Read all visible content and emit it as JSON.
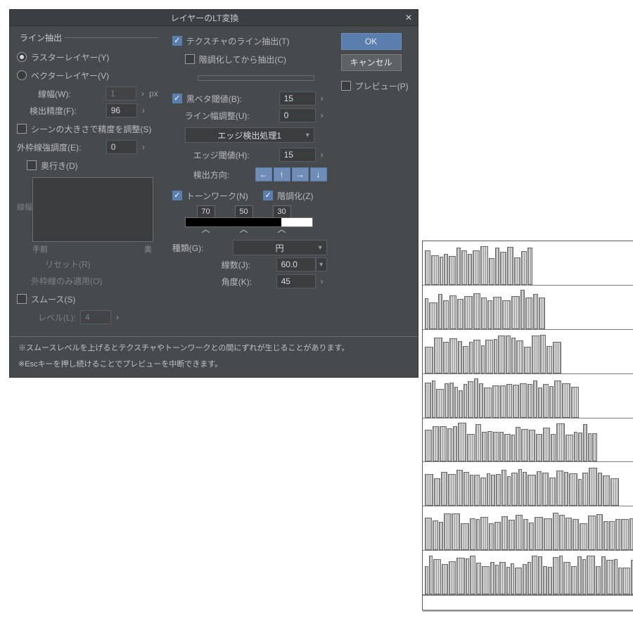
{
  "title": "レイヤーのLT変換",
  "buttons": {
    "ok": "OK",
    "cancel": "キャンセル"
  },
  "preview": {
    "label": "プレビュー(P)",
    "checked": false
  },
  "left": {
    "group": "ライン抽出",
    "raster": "ラスターレイヤー(Y)",
    "vector": "ベクターレイヤー(V)",
    "lineWidth": {
      "label": "線幅(W):",
      "value": "1",
      "unit": "px"
    },
    "detect": {
      "label": "検出精度(F):",
      "value": "96"
    },
    "scale": {
      "label": "シーンの大きさで精度を調整(S)",
      "checked": false
    },
    "outline": {
      "label": "外枠線強調度(E):",
      "value": "0"
    },
    "depth": {
      "label": "奥行き(D)",
      "checked": false
    },
    "curve": {
      "y": "線幅",
      "xmin": "手前",
      "xmax": "奥"
    },
    "reset": "リセット(R)",
    "outlineOnly": "外枠線のみ適用(O)",
    "smooth": {
      "label": "スムース(S)",
      "checked": false,
      "levelLabel": "レベル(L):",
      "level": "4"
    }
  },
  "mid": {
    "tex": {
      "label": "テクスチャのライン抽出(T)",
      "checked": true
    },
    "post": {
      "label": "階調化してから抽出(C)",
      "checked": false
    },
    "black": {
      "label": "黒ベタ閾値(B):",
      "value": "15",
      "checked": true
    },
    "adj": {
      "label": "ライン幅調整(U):",
      "value": "0"
    },
    "edgeProc": "エッジ検出処理1",
    "edgeTh": {
      "label": "エッジ閾値(H):",
      "value": "15"
    },
    "dir": "検出方向:",
    "tone": {
      "label": "トーンワーク(N)",
      "checked": true
    },
    "poster": {
      "label": "階調化(Z)",
      "checked": true,
      "v1": "70",
      "v2": "50",
      "v3": "30"
    },
    "kind": {
      "label": "種類(G):",
      "value": "円"
    },
    "lines": {
      "label": "線数(J):",
      "value": "60.0"
    },
    "angle": {
      "label": "角度(K):",
      "value": "45"
    }
  },
  "notes": {
    "n1": "※スムースレベルを上げるとテクスチャやトーンワークとの間にずれが生じることがあります。",
    "n2": "※Escキーを押し続けることでプレビューを中断できます。"
  }
}
